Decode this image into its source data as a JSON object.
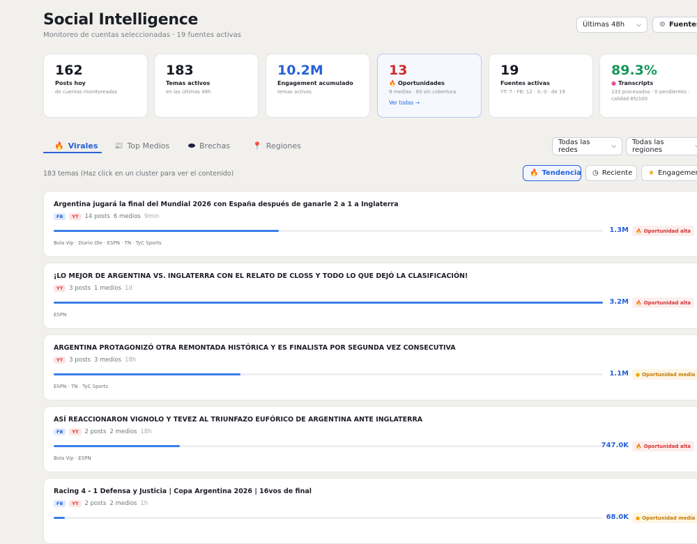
{
  "header": {
    "title": "Social Intelligence",
    "subtitle": "Monitoreo de cuentas seleccionadas · 19 fuentes activas",
    "time_filter": "Últimas 48h",
    "sources_button": "Fuentes"
  },
  "kpis": [
    {
      "value": "162",
      "label": "Posts hoy",
      "sub": "de cuentas monitoreadas",
      "color": "#141821"
    },
    {
      "value": "183",
      "label": "Temas activos",
      "sub": "en las últimas 48h",
      "color": "#141821"
    },
    {
      "value": "10.2M",
      "label": "Engagement acumulado",
      "sub": "temas activos",
      "color": "#2761d8"
    },
    {
      "value": "13",
      "label": "Oportunidades",
      "sub": "9 medias · 60 sin cobertura",
      "link": "Ver todas →",
      "color": "#d02828",
      "icon": "fire-icon"
    },
    {
      "value": "19",
      "label": "Fuentes activas",
      "sub": "YT: 7 · FB: 12 · X: 0 · de 19",
      "color": "#141821"
    },
    {
      "value": "89.3%",
      "label": "Transcripts",
      "sub": "133 procesados · 0 pendientes · calidad 85/100",
      "color": "#15975a",
      "icon": "brain-icon"
    }
  ],
  "tabs": [
    {
      "label": "Virales",
      "icon": "fire-icon",
      "active": true
    },
    {
      "label": "Top Medios",
      "icon": "newspaper-icon"
    },
    {
      "label": "Brechas",
      "icon": "hole-icon"
    },
    {
      "label": "Regiones",
      "icon": "pin-icon"
    }
  ],
  "filters": {
    "network": "Todas las redes",
    "region": "Todas las regiones"
  },
  "topics_count": "183 temas (Haz click en un cluster para ver el contenido)",
  "sort": [
    {
      "label": "Tendencia",
      "icon": "fire-icon",
      "active": true
    },
    {
      "label": "Reciente",
      "icon": "clock-icon"
    },
    {
      "label": "Engagement",
      "icon": "star-icon"
    }
  ],
  "topics": [
    {
      "title": "Argentina jugará la final del Mundial 2026 con España después de ganarle 2 a 1 a Inglaterra",
      "tags": [
        "FB",
        "YT"
      ],
      "posts": "14 posts",
      "media": "6 medios",
      "age": "9min",
      "engagement": "1.3M",
      "engagement_value": 1300000,
      "share": 0.41,
      "opportunity": "Oportunidad alta",
      "level": "alta",
      "sources": "Bola Vip · Diario Ole · ESPN · TN · TyC Sports"
    },
    {
      "title": "¡LO MEJOR DE ARGENTINA VS. INGLATERRA CON EL RELATO DE CLOSS Y TODO LO QUE DEJÓ LA CLASIFICACIÓN!",
      "tags": [
        "YT"
      ],
      "posts": "3 posts",
      "media": "1 medios",
      "age": "1d",
      "engagement": "3.2M",
      "engagement_value": 3200000,
      "share": 1.0,
      "opportunity": "Oportunidad alta",
      "level": "alta",
      "sources": "ESPN"
    },
    {
      "title": "ARGENTINA PROTAGONIZÓ OTRA REMONTADA HISTÓRICA Y ES FINALISTA POR SEGUNDA VEZ CONSECUTIVA",
      "tags": [
        "YT"
      ],
      "posts": "3 posts",
      "media": "3 medios",
      "age": "18h",
      "engagement": "1.1M",
      "engagement_value": 1100000,
      "share": 0.34,
      "opportunity": "Oportunidad media",
      "level": "media",
      "sources": "ESPN · TN · TyC Sports"
    },
    {
      "title": "ASÍ REACCIONARON VIGNOLO Y TEVEZ AL TRIUNFAZO EUFÓRICO DE ARGENTINA ANTE INGLATERRA",
      "tags": [
        "FB",
        "YT"
      ],
      "posts": "2 posts",
      "media": "2 medios",
      "age": "18h",
      "engagement": "747.0K",
      "engagement_value": 747000,
      "share": 0.23,
      "opportunity": "Oportunidad alta",
      "level": "alta",
      "sources": "Bola Vip · ESPN"
    },
    {
      "title": "Racing 4 - 1 Defensa y Justicia | Copa Argentina 2026 | 16vos de final",
      "tags": [
        "FB",
        "YT"
      ],
      "posts": "2 posts",
      "media": "2 medios",
      "age": "1h",
      "engagement": "68.0K",
      "engagement_value": 68000,
      "share": 0.02,
      "opportunity": "Oportunidad media",
      "level": "media",
      "sources": ""
    }
  ]
}
